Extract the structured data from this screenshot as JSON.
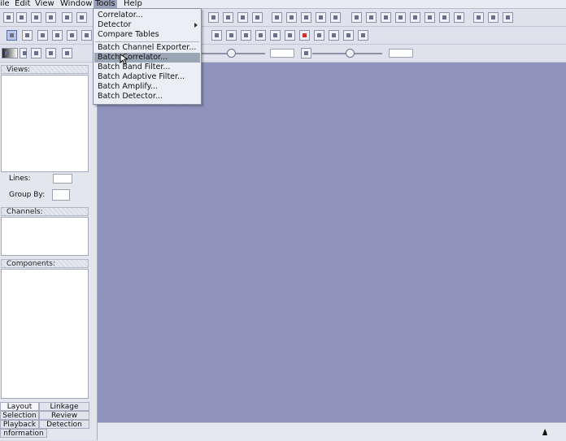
{
  "menubar": {
    "items": [
      "ile",
      "Edit",
      "View",
      "Window",
      "Tools",
      "Help"
    ]
  },
  "tools_menu": {
    "items": [
      {
        "label": "Correlator..."
      },
      {
        "label": "Detector"
      },
      {
        "label": "Compare Tables"
      },
      {
        "label": "Batch Channel Exporter..."
      },
      {
        "label": "Batch Correlator..."
      },
      {
        "label": "Batch Band Filter..."
      },
      {
        "label": "Batch Adaptive Filter..."
      },
      {
        "label": "Batch Amplify..."
      },
      {
        "label": "Batch Detector..."
      }
    ],
    "hovered_index": 4
  },
  "left_panel": {
    "views_title": "Views:",
    "lines_label": "Lines:",
    "group_by_label": "Group By:",
    "channels_title": "Channels:",
    "components_title": "Components:"
  },
  "bottom_tabs": {
    "row1": [
      "Layout",
      "Linkage"
    ],
    "row2": [
      "Selection",
      "Review"
    ],
    "row3": [
      "Playback",
      "Detection"
    ],
    "row4": [
      "nformation"
    ]
  },
  "colors": {
    "canvas": "#8c8fba",
    "menu_hover": "#9aa5b5"
  }
}
